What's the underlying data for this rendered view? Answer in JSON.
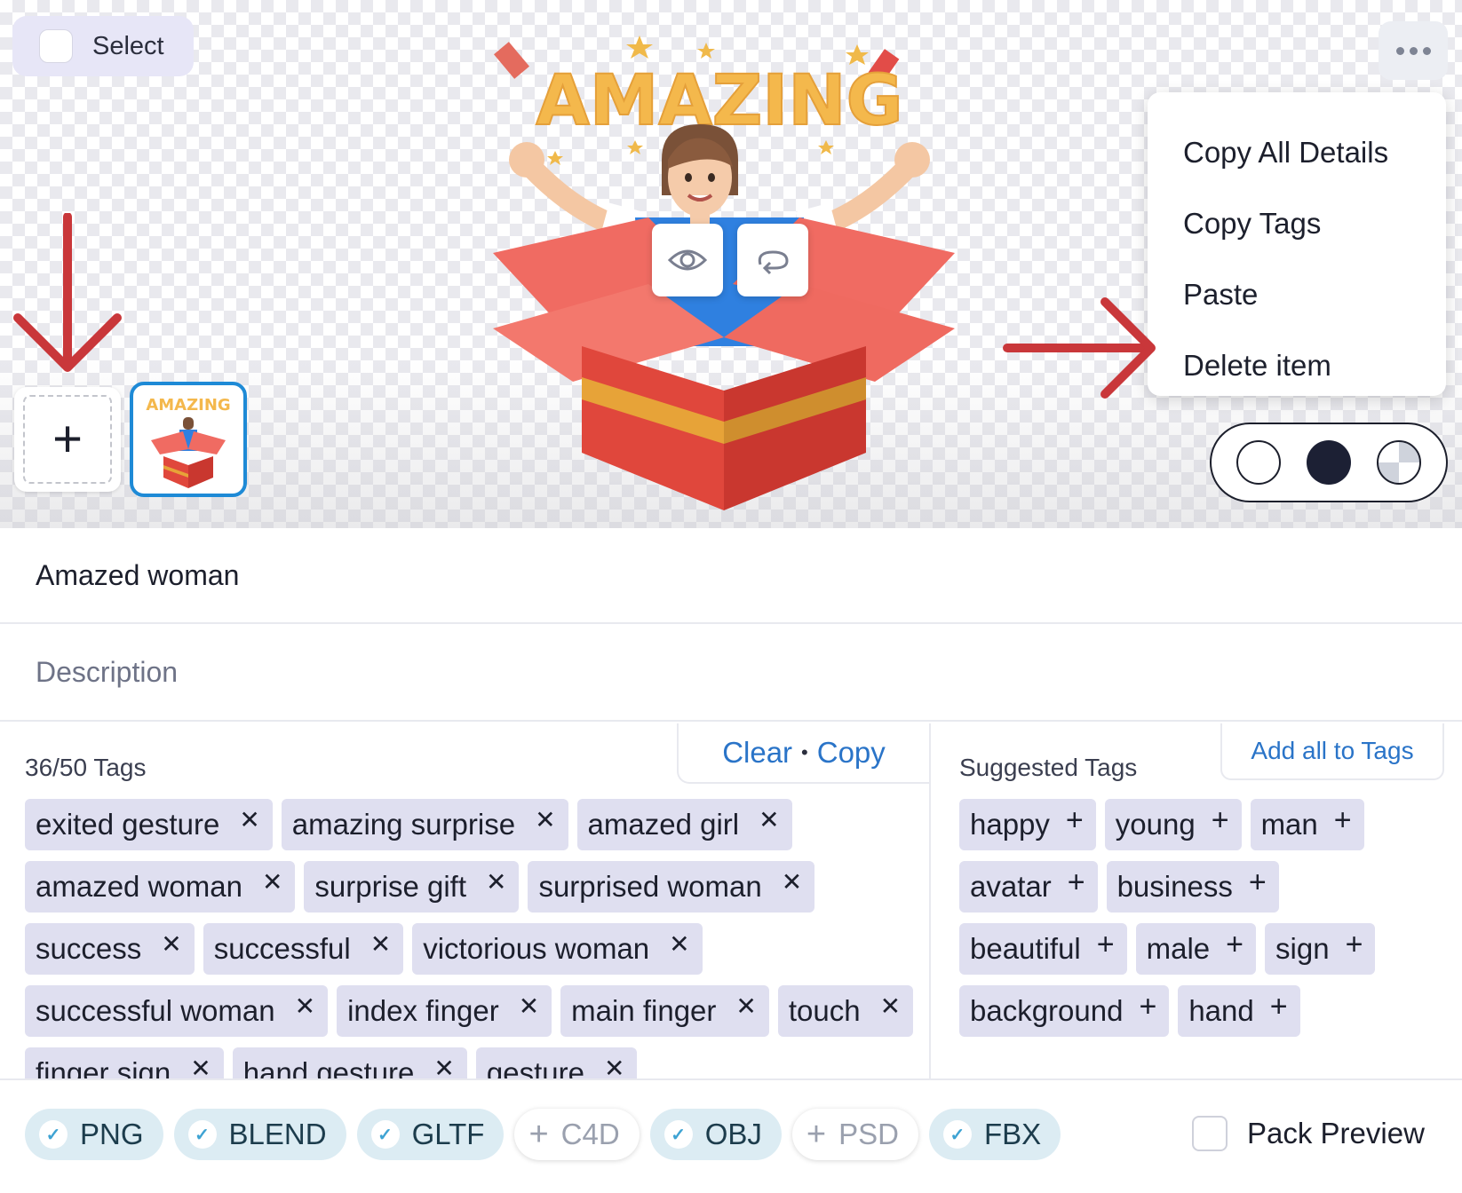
{
  "header": {
    "select_label": "Select"
  },
  "menu": {
    "items": [
      "Copy All Details",
      "Copy Tags",
      "Paste",
      "Delete item"
    ]
  },
  "art": {
    "headline": "AMAZING"
  },
  "colors": {
    "accent_blue": "#1e8ad6",
    "link_blue": "#2a74c8",
    "tag_bg": "#dfdff0",
    "format_on_bg": "#dcecf3",
    "annotation_red": "#c9373a"
  },
  "details": {
    "title": "Amazed woman",
    "description_placeholder": "Description"
  },
  "tags": {
    "count_label": "36/50 Tags",
    "clear_label": "Clear",
    "separator": "•",
    "copy_label": "Copy",
    "items": [
      "exited gesture",
      "amazing surprise",
      "amazed girl",
      "amazed woman",
      "surprise gift",
      "surprised woman",
      "success",
      "successful",
      "victorious woman",
      "successful woman",
      "index finger",
      "main finger",
      "touch",
      "finger sign",
      "hand gesture",
      "gesture"
    ]
  },
  "suggested": {
    "label": "Suggested Tags",
    "add_all_label": "Add all to Tags",
    "items": [
      "happy",
      "young",
      "man",
      "avatar",
      "business",
      "beautiful",
      "male",
      "sign",
      "background",
      "hand"
    ]
  },
  "formats": [
    {
      "label": "PNG",
      "selected": true
    },
    {
      "label": "BLEND",
      "selected": true
    },
    {
      "label": "GLTF",
      "selected": true
    },
    {
      "label": "C4D",
      "selected": false
    },
    {
      "label": "OBJ",
      "selected": true
    },
    {
      "label": "PSD",
      "selected": false
    },
    {
      "label": "FBX",
      "selected": true
    }
  ],
  "pack_preview": {
    "label": "Pack Preview",
    "checked": false
  },
  "icons": {
    "close": "✕",
    "add": "+",
    "check": "✓",
    "more": "more-horizontal-icon",
    "eye": "eye-icon",
    "swap": "swap-icon"
  }
}
